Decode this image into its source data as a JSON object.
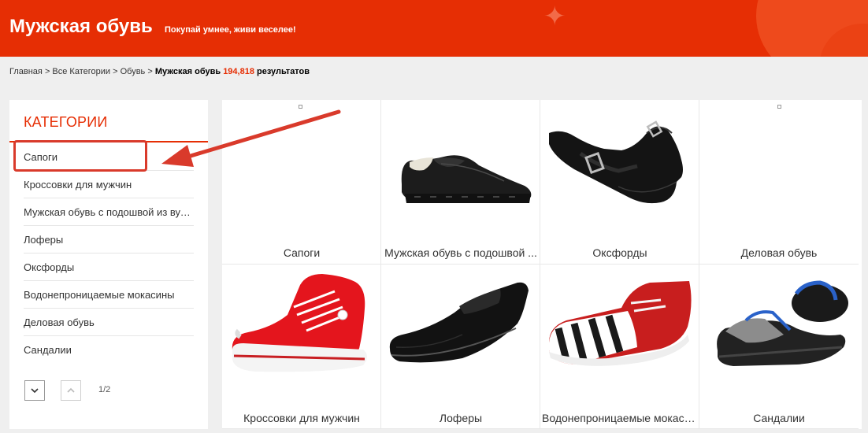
{
  "header": {
    "title": "Мужская обувь",
    "slogan": "Покупай умнее, живи веселее!"
  },
  "breadcrumb": {
    "home": "Главная",
    "sep": ">",
    "all": "Все Категории",
    "shoes": "Обувь",
    "current": "Мужская обувь",
    "count": "194,818",
    "results_word": "результатов"
  },
  "sidebar": {
    "title": "КАТЕГОРИИ",
    "items": [
      {
        "label": "Сапоги"
      },
      {
        "label": "Кроссовки для мужчин"
      },
      {
        "label": "Мужская обувь с подошвой из вулк..."
      },
      {
        "label": "Лоферы"
      },
      {
        "label": "Оксфорды"
      },
      {
        "label": "Водонепроницаемые мокасины"
      },
      {
        "label": "Деловая обувь"
      },
      {
        "label": "Сандалии"
      }
    ],
    "pager": "1/2"
  },
  "grid": {
    "items": [
      {
        "label": "Сапоги",
        "image": "broken-image"
      },
      {
        "label": "Мужская обувь с подошвой ...",
        "image": "black-derby-shoe"
      },
      {
        "label": "Оксфорды",
        "image": "black-monk-strap-shoe"
      },
      {
        "label": "Деловая обувь",
        "image": "broken-image"
      },
      {
        "label": "Кроссовки для мужчин",
        "image": "red-high-top-sneaker"
      },
      {
        "label": "Лоферы",
        "image": "black-loafer"
      },
      {
        "label": "Водонепроницаемые мокаси...",
        "image": "red-striped-sneaker"
      },
      {
        "label": "Сандалии",
        "image": "sport-sandal"
      }
    ]
  },
  "colors": {
    "brand": "#e62e04",
    "annotation": "#d93a2b"
  }
}
